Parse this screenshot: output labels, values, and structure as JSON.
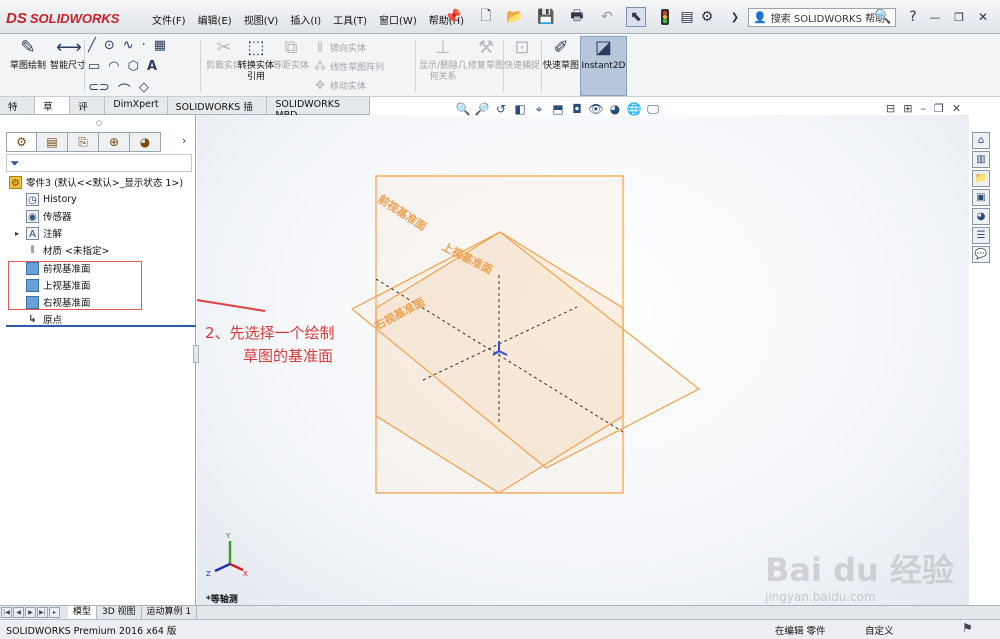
{
  "app": {
    "brand": "SOLIDWORKS",
    "brand_mark": "DS"
  },
  "menus": [
    "文件(F)",
    "编辑(E)",
    "视图(V)",
    "插入(I)",
    "工具(T)",
    "窗口(W)",
    "帮助(H)"
  ],
  "search": {
    "placeholder": "搜索 SOLIDWORKS 帮助"
  },
  "commands": {
    "sketch": "草图绘制",
    "smart_dim": "智能尺寸",
    "trim": "剪裁实体",
    "convert": "转换实体引用",
    "offset": "等距实体",
    "mirror": "镜向实体",
    "linear_pattern": "线性草图阵列",
    "move": "移动实体",
    "relations": "显示/删除几何关系",
    "repair": "修复草图",
    "quick_snaps": "快速捕捉",
    "rapid_sketch": "快速草图",
    "instant2d": "Instant2D"
  },
  "tabs": [
    "特征",
    "草图",
    "评估",
    "DimXpert",
    "SOLIDWORKS 插件",
    "SOLIDWORKS MBD"
  ],
  "tree": {
    "root": "零件3 (默认<<默认>_显示状态 1>)",
    "history": "History",
    "sensors": "传感器",
    "annotations": "注解",
    "material": "材质 <未指定>",
    "front_plane": "前视基准面",
    "top_plane": "上视基准面",
    "right_plane": "右视基准面",
    "origin": "原点"
  },
  "annotation": {
    "line1": "2、先选择一个绘制",
    "line2": "草图的基准面"
  },
  "viewport": {
    "plane_front": "前视基准面",
    "plane_top": "上视基准面",
    "plane_right": "右视基准面",
    "view_name": "*等轴测",
    "triad": {
      "x": "X",
      "y": "Y",
      "z": "Z"
    },
    "plane_color": "#f5a04a"
  },
  "bottom_tabs": [
    "模型",
    "3D 视图",
    "运动算例 1"
  ],
  "status": {
    "product": "SOLIDWORKS Premium 2016 x64 版",
    "editing": "在编辑 零件",
    "custom": "自定义"
  },
  "watermark": {
    "main": "Bai du 经验",
    "sub": "jingyan.baidu.com"
  }
}
